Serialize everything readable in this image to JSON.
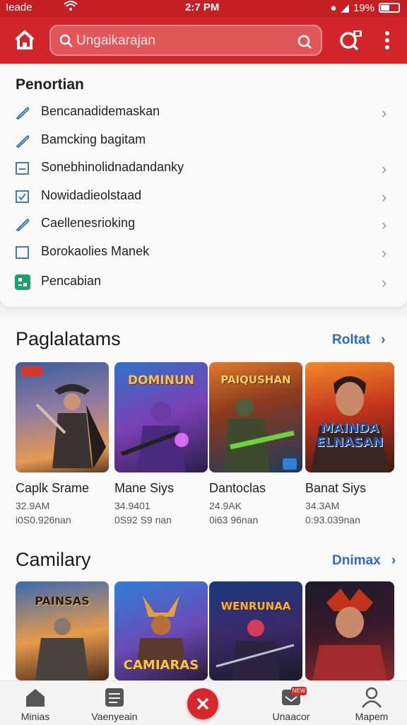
{
  "status": {
    "carrier": "Ieade",
    "time": "2:7 PM",
    "battery": "19%"
  },
  "search": {
    "placeholder": "Ungaikarajan"
  },
  "menu": {
    "title": "Penortian",
    "items": [
      {
        "label": "Bencanadidemaskan",
        "icon": "pencil-icon"
      },
      {
        "label": "Bamcking bagitam",
        "icon": "pencil-icon"
      },
      {
        "label": "Sonebhinolidnadandanky",
        "icon": "checkbox-icon"
      },
      {
        "label": "Nowidadieolstaad",
        "icon": "checked-box-icon"
      },
      {
        "label": "Caellenesrioking",
        "icon": "pencil-icon"
      },
      {
        "label": "Borokaolies Manek",
        "icon": "empty-box-icon"
      },
      {
        "label": "Pencabian",
        "icon": "green-app-icon"
      }
    ]
  },
  "section1": {
    "title": "Paglalatams",
    "link": "Roltat",
    "cards": [
      {
        "name": "Caplk Srame",
        "meta": "32.9AM",
        "meta2": "i0S0.926nan"
      },
      {
        "name": "Mane Siys",
        "meta": "34.9401",
        "meta2": "0S92 S9 nan",
        "art": "DOMINUN"
      },
      {
        "name": "Dantoclas",
        "meta": "24.9AK",
        "meta2": "0i63 96nan",
        "art": "PAIQUSHAN"
      },
      {
        "name": "Banat Siys",
        "meta": "34.3AM",
        "meta2": "0:93.039nan",
        "art": "MAINDA ELNASAN"
      }
    ]
  },
  "section2": {
    "title": "Camilary",
    "link": "Dnimax",
    "cards": [
      {
        "art": "PAINSAS"
      },
      {
        "art": "CAMIARAS"
      },
      {
        "art": "WENRUNAA"
      },
      {
        "art": ""
      }
    ]
  },
  "bottom_nav": [
    {
      "label": "Minias"
    },
    {
      "label": "Vaenyeain"
    },
    {
      "label": ""
    },
    {
      "label": "Unaacor",
      "badge": "NEW"
    },
    {
      "label": "Mapem"
    }
  ],
  "colors": {
    "brand_red": "#d0262a",
    "link_blue": "#2f6bc4"
  }
}
